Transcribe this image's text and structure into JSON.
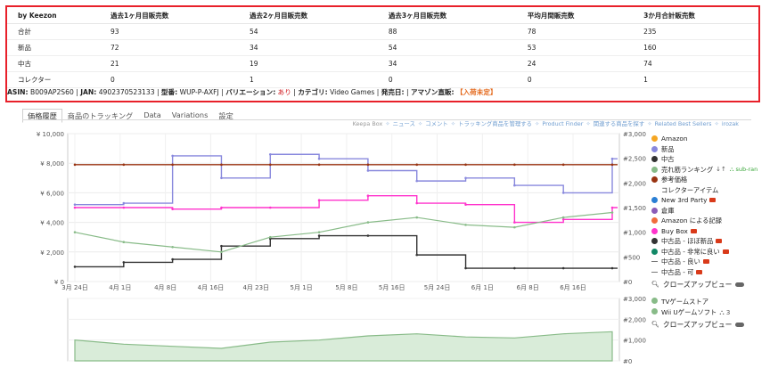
{
  "stats": {
    "headers": [
      "by Keezon",
      "過去1ヶ月目販売数",
      "過去2ヶ月目販売数",
      "過去3ヶ月目販売数",
      "平均月間販売数",
      "3か月合計販売数"
    ],
    "rows": [
      [
        "合計",
        "93",
        "54",
        "88",
        "78",
        "235"
      ],
      [
        "新品",
        "72",
        "34",
        "54",
        "53",
        "160"
      ],
      [
        "中古",
        "21",
        "19",
        "34",
        "24",
        "74"
      ],
      [
        "コレクター",
        "0",
        "1",
        "0",
        "0",
        "1"
      ]
    ]
  },
  "meta": {
    "asin_label": "ASIN:",
    "asin_value": "B009AP2S60",
    "jan_label": "JAN:",
    "jan_value": "4902370523133",
    "model_label": "型番:",
    "model_value": "WUP-P-AXFJ",
    "variation_label": "バリエーション:",
    "variation_value": "あり",
    "category_label": "カテゴリ:",
    "category_value": "Video Games",
    "release_label": "発売日:",
    "amazon_label": "アマゾン直販:",
    "amazon_value": "【入荷未定】"
  },
  "tabs": [
    "価格履歴",
    "商品のトラッキング",
    "Data",
    "Variations",
    "設定"
  ],
  "links": [
    "Keepa Box",
    "ニュース",
    "コメント",
    "トラッキング商品を管理する",
    "Product Finder",
    "関連する商品を探す",
    "Related Best Sellers",
    "irozak"
  ],
  "axes": {
    "left_ticks": [
      "¥ 10,000",
      "¥ 8,000",
      "¥ 6,000",
      "¥ 4,000",
      "¥ 2,000",
      "¥ 0"
    ],
    "right_ticks": [
      "#3,000",
      "#2,500",
      "#2,000",
      "#1,500",
      "#1,000",
      "#500",
      "#0"
    ],
    "x_ticks": [
      "3月 24日",
      "4月 1日",
      "4月 8日",
      "4月 16日",
      "4月 23日",
      "5月 1日",
      "5月 8日",
      "5月 16日",
      "5月 24日",
      "6月 1日",
      "6月 8日",
      "6月 16日"
    ],
    "bottom_right_ticks": [
      "#3,000",
      "#2,000",
      "#1,000",
      "#0"
    ]
  },
  "legend": {
    "items": [
      {
        "label": "Amazon",
        "color": "#f5a623",
        "icon": "dot"
      },
      {
        "label": "新品",
        "color": "#8888dd",
        "icon": "dot"
      },
      {
        "label": "中古",
        "color": "#333333",
        "icon": "dot"
      },
      {
        "label": "売れ筋ランキング",
        "color": "#88bb88",
        "icon": "dot",
        "suffix": "sub-ran"
      },
      {
        "label": "参考価格",
        "color": "#993311",
        "icon": "dot"
      },
      {
        "label": "コレクターアイテム",
        "color": "",
        "icon": "none"
      },
      {
        "label": "New 3rd Party",
        "color": "#2a7fd4",
        "icon": "dot",
        "truck": true
      },
      {
        "label": "倉庫",
        "color": "#8b5cb8",
        "icon": "dot"
      },
      {
        "label": "Amazon による記録",
        "color": "#f06c3c",
        "icon": "dot"
      },
      {
        "label": "Buy Box",
        "color": "#ff33cc",
        "icon": "dot",
        "truck": true
      },
      {
        "label": "中古品 - ほぼ新品",
        "color": "#333333",
        "icon": "dot",
        "truck": true
      },
      {
        "label": "中古品 - 非常に良い",
        "color": "#118866",
        "icon": "dot",
        "truck": true
      },
      {
        "label": "中古品 - 良い",
        "color": "#777777",
        "icon": "dash",
        "truck": true
      },
      {
        "label": "中古品 - 可",
        "color": "#777777",
        "icon": "dash",
        "truck": true
      }
    ],
    "closeup_label": "クローズアップビュー"
  },
  "legend2": {
    "items": [
      {
        "label": "TVゲームストア",
        "color": "#88bb88"
      },
      {
        "label": "Wii Uゲームソフト",
        "color": "#88bb88",
        "suffix": "3"
      }
    ],
    "closeup_label": "クローズアップビュー"
  },
  "chart_data": {
    "type": "line",
    "x": [
      "3月 24日",
      "4月 1日",
      "4月 8日",
      "4月 16日",
      "4月 23日",
      "5月 1日",
      "5月 8日",
      "5月 16日",
      "5月 24日",
      "6月 1日",
      "6月 8日",
      "6月 16日"
    ],
    "ylim": [
      0,
      10000
    ],
    "y2lim": [
      0,
      3000
    ],
    "series": [
      {
        "name": "新品",
        "color": "#8888dd",
        "values": [
          5200,
          5300,
          8500,
          7000,
          8600,
          8300,
          7500,
          6800,
          7000,
          6500,
          6000,
          8300
        ]
      },
      {
        "name": "中古",
        "color": "#333333",
        "values": [
          1000,
          1300,
          1500,
          2400,
          2900,
          3100,
          3100,
          1800,
          900,
          900,
          900,
          900
        ]
      },
      {
        "name": "参考価格",
        "color": "#993311",
        "values": [
          7900,
          7900,
          7900,
          7900,
          7900,
          7900,
          7900,
          7900,
          7900,
          7900,
          7900,
          7900
        ]
      },
      {
        "name": "Buy Box",
        "color": "#ff33cc",
        "values": [
          5000,
          5000,
          4900,
          5000,
          5000,
          5500,
          5800,
          5300,
          5200,
          4000,
          4200,
          5000
        ]
      },
      {
        "name": "売れ筋ランキング",
        "color": "#88bb88",
        "values": [
          1000,
          800,
          700,
          600,
          900,
          1000,
          1200,
          1300,
          1150,
          1100,
          1300,
          1400
        ]
      }
    ]
  }
}
